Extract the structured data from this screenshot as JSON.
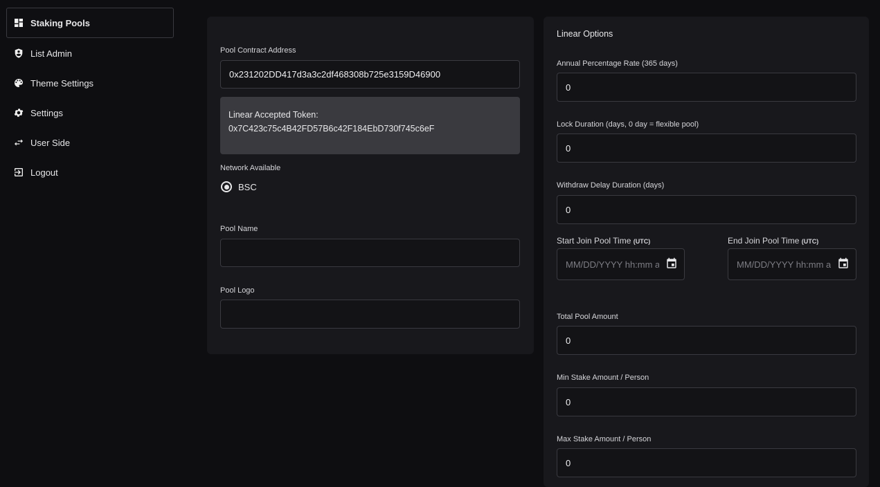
{
  "sidebar": {
    "items": [
      {
        "label": "Staking Pools",
        "icon": "dashboard-icon",
        "active": true
      },
      {
        "label": "List Admin",
        "icon": "admin-shield-icon"
      },
      {
        "label": "Theme Settings",
        "icon": "palette-icon"
      },
      {
        "label": "Settings",
        "icon": "gear-icon"
      },
      {
        "label": "User Side",
        "icon": "swap-arrows-icon"
      },
      {
        "label": "Logout",
        "icon": "logout-icon"
      }
    ]
  },
  "pool_form": {
    "contract_address_label": "Pool Contract Address",
    "contract_address_value": "0x231202DD417d3a3c2df468308b725e3159D46900",
    "accepted_token_label": "Linear Accepted Token:",
    "accepted_token_value": "0x7C423c75c4B42FD57B6c42F184EbD730f745c6eF",
    "network_label": "Network Available",
    "network_option": "BSC",
    "pool_name_label": "Pool Name",
    "pool_name_value": "",
    "pool_logo_label": "Pool Logo",
    "pool_logo_value": ""
  },
  "linear_options": {
    "title": "Linear Options",
    "apr_label": "Annual Percentage Rate (365 days)",
    "apr_value": "0",
    "lock_label": "Lock Duration (days, 0 day = flexible pool)",
    "lock_value": "0",
    "withdraw_label": "Withdraw Delay Duration (days)",
    "withdraw_value": "0",
    "start_label": "Start Join Pool Time",
    "end_label": "End Join Pool Time",
    "utc": "(UTC)",
    "date_placeholder": "MM/DD/YYYY hh:mm aa",
    "total_label": "Total Pool Amount",
    "total_value": "0",
    "min_label": "Min Stake Amount / Person",
    "min_value": "0",
    "max_label": "Max Stake Amount / Person",
    "max_value": "0"
  },
  "colors": {
    "background": "#0e0e11",
    "card": "#18181c",
    "token_box": "#3a3a3f",
    "border": "#3a3a40"
  }
}
